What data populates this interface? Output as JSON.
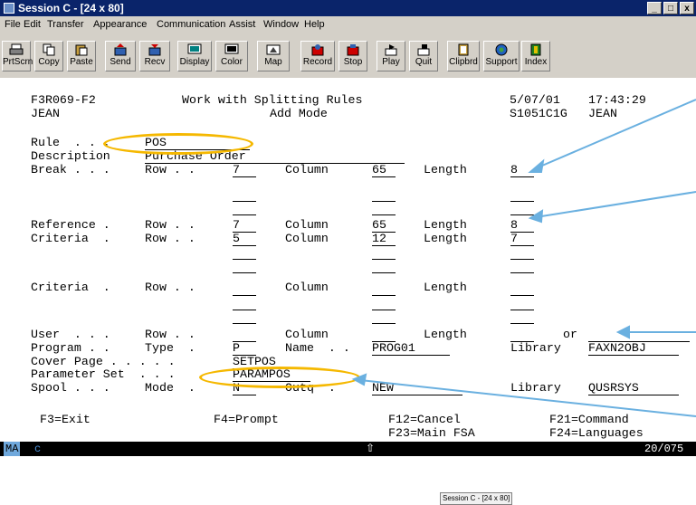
{
  "window": {
    "title": "Session C - [24 x 80]",
    "controls": [
      "_",
      "□",
      "x"
    ]
  },
  "menu": [
    "File",
    "Edit",
    "Transfer",
    "Appearance",
    "Communication",
    "Assist",
    "Window",
    "Help"
  ],
  "toolbar": [
    {
      "label": "PrtScrn",
      "icon": "printer-icon"
    },
    {
      "label": "Copy",
      "icon": "copy-icon"
    },
    {
      "label": "Paste",
      "icon": "paste-icon"
    },
    {
      "label": "Send",
      "icon": "send-icon"
    },
    {
      "label": "Recv",
      "icon": "receive-icon"
    },
    {
      "label": "Display",
      "icon": "display-icon"
    },
    {
      "label": "Color",
      "icon": "color-icon"
    },
    {
      "label": "Map",
      "icon": "map-icon"
    },
    {
      "label": "Record",
      "icon": "record-icon"
    },
    {
      "label": "Stop",
      "icon": "stop-icon"
    },
    {
      "label": "Play",
      "icon": "play-icon"
    },
    {
      "label": "Quit",
      "icon": "quit-icon"
    },
    {
      "label": "Clipbrd",
      "icon": "clipboard-icon"
    },
    {
      "label": "Support",
      "icon": "support-icon"
    },
    {
      "label": "Index",
      "icon": "index-icon"
    }
  ],
  "screen": {
    "program_id": "F3R069-F2",
    "screen_title": "Work with Splitting Rules",
    "date": "5/07/01",
    "time": "17:43:29",
    "user": "JEAN",
    "mode": "Add Mode",
    "device": "S1051C1G",
    "user2": "JEAN",
    "rule_label": "Rule  . . .",
    "rule_value": "POS",
    "description_label": "Description",
    "description_value": "Purchase Order",
    "break_label": "Break . . .",
    "reference_label": "Reference .",
    "criteria_label": "Criteria  .",
    "criteria2_label": "Criteria  .",
    "user_label": "User  . . .",
    "row_label": "Row . .",
    "column_label": "Column",
    "length_label": "Length",
    "break": {
      "row": "7",
      "column": "65",
      "length": "8"
    },
    "reference": {
      "row": "7",
      "column": "65",
      "length": "8"
    },
    "criteria": {
      "row": "5",
      "column": "12",
      "length": "7"
    },
    "or_label": "or",
    "program_label": "Program . .",
    "type_label": "Type  .",
    "type_value": "P",
    "name_label": "Name  . .",
    "name_value": "PROG01",
    "library_label": "Library",
    "library_value": "FAXN2OBJ",
    "cover_label": "Cover Page . . . . .",
    "cover_value": "SETPOS",
    "param_label": "Parameter Set  . . .",
    "param_value": "PARAMPOS",
    "spool_label": "Spool . . .",
    "spool_mode_label": "Mode  .",
    "spool_mode_value": "N",
    "outq_label": "Outq  .",
    "outq_value": "NEW",
    "spool_library_label": "Library",
    "spool_library_value": "QUSRSYS",
    "f3": "F3=Exit",
    "f4": "F4=Prompt",
    "f12": "F12=Cancel",
    "f21": "F21=Command",
    "f23": "F23=Main FSA",
    "f24": "F24=Languages"
  },
  "statusbar": {
    "indicator": "MA",
    "session": "c",
    "arrow": "⇧",
    "position": "20/075"
  },
  "caption": "Session C - [24 x 80]",
  "colors": {
    "title_bar": "#0a246a",
    "highlight_oval": "#f5b800",
    "arrow": "#6ab0e0"
  }
}
